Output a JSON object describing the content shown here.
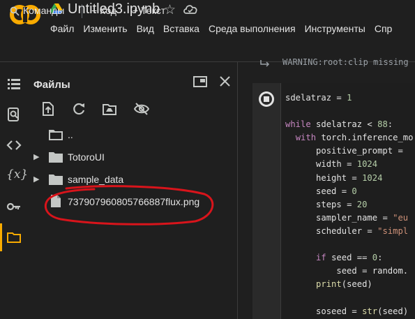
{
  "header": {
    "title": "Untitled3.ipynb",
    "logo_text": "CO",
    "menu": [
      "Файл",
      "Изменить",
      "Вид",
      "Вставка",
      "Среда выполнения",
      "Инструменты",
      "Спр"
    ]
  },
  "toolbar": {
    "commands_label": "Команды",
    "add_code_label": "+ Код",
    "add_text_label": "+ Текст"
  },
  "files_panel": {
    "title": "Файлы",
    "tree": [
      {
        "name": "..",
        "type": "folder-up"
      },
      {
        "name": "TotoroUI",
        "type": "folder"
      },
      {
        "name": "sample_data",
        "type": "folder"
      },
      {
        "name": "737907960805766887flux.png",
        "type": "file"
      }
    ]
  },
  "notebook": {
    "warning_text": "WARNING:root:clip missing",
    "code_lines": [
      "sdelatraz = 1",
      "",
      "while sdelatraz < 88:",
      "  with torch.inference_mo",
      "      positive_prompt =",
      "      width = 1024",
      "      height = 1024",
      "      seed = 0",
      "      steps = 20",
      "      sampler_name = \"eu",
      "      scheduler = \"simpl",
      "",
      "      if seed == 0:",
      "          seed = random.",
      "      print(seed)",
      "",
      "      soseed = str(seed)"
    ]
  },
  "colors": {
    "accent": "#f9ab00",
    "annotation": "#d8141b"
  }
}
